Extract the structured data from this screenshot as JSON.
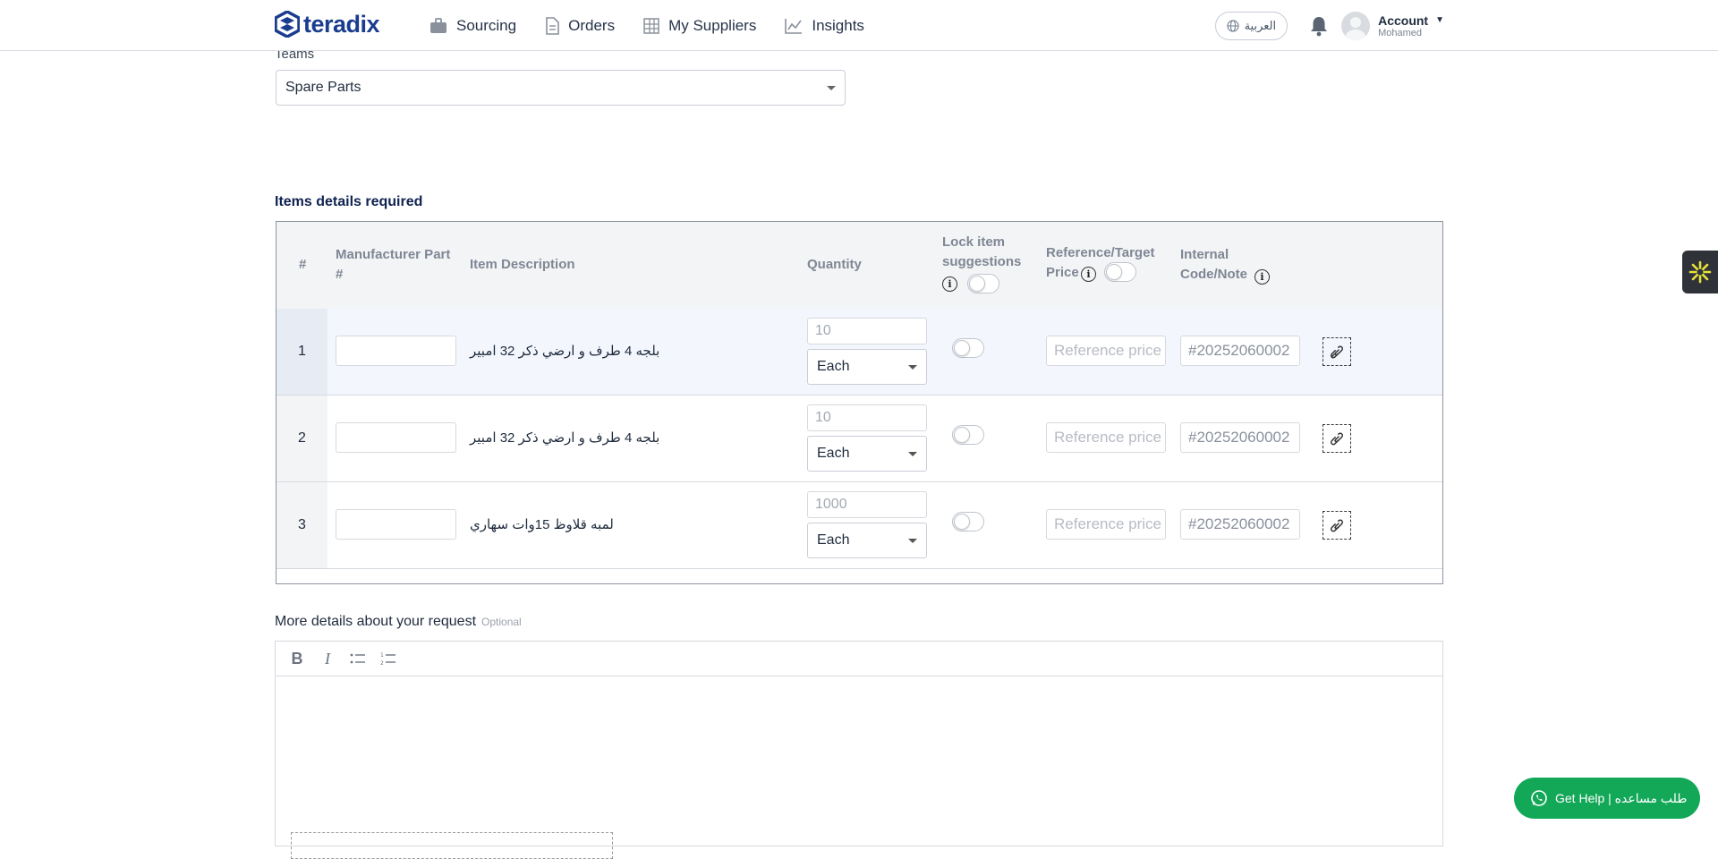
{
  "nav": {
    "brand": "teradix",
    "items": [
      {
        "label": "Sourcing",
        "icon": "briefcase-icon"
      },
      {
        "label": "Orders",
        "icon": "document-icon"
      },
      {
        "label": "My Suppliers",
        "icon": "building-icon"
      },
      {
        "label": "Insights",
        "icon": "line-chart-icon"
      }
    ],
    "language_label": "العربية",
    "account_label": "Account",
    "account_user": "Mohamed"
  },
  "teams": {
    "label": "Teams",
    "selected": "Spare Parts"
  },
  "items_section": {
    "title": "Items details required",
    "headers": {
      "num": "#",
      "part": "Manufacturer Part #",
      "description": "Item Description",
      "quantity": "Quantity",
      "lock": "Lock item suggestions",
      "price": "Reference/Target Price",
      "code": "Internal Code/Note"
    },
    "lock_all": false,
    "price_toggle": false,
    "rows": [
      {
        "num": "1",
        "part": "",
        "description": "بلجه 4 طرف و ارضي ذكر 32 امبير",
        "quantity": "10",
        "unit": "Each",
        "lock": false,
        "price_placeholder": "Reference price",
        "code": "#20252060002",
        "selected": true
      },
      {
        "num": "2",
        "part": "",
        "description": "بلجه 4 طرف و ارضي ذكر 32 امبير",
        "quantity": "10",
        "unit": "Each",
        "lock": false,
        "price_placeholder": "Reference price",
        "code": "#20252060002",
        "selected": false
      },
      {
        "num": "3",
        "part": "",
        "description": "لمبه قلاوظ 15وات سهاري",
        "quantity": "1000",
        "unit": "Each",
        "lock": false,
        "price_placeholder": "Reference price",
        "code": "#20252060002",
        "selected": false
      }
    ]
  },
  "more_details": {
    "label": "More details about your request",
    "optional": "Optional",
    "toolbar": [
      "bold-icon",
      "italic-icon",
      "bullet-list-icon",
      "numbered-list-icon"
    ]
  },
  "help": {
    "label": "Get Help | طلب مساعده"
  },
  "colors": {
    "brand": "#1b3d8f",
    "help_green": "#13a858",
    "selected_row": "#f3f6fd"
  }
}
